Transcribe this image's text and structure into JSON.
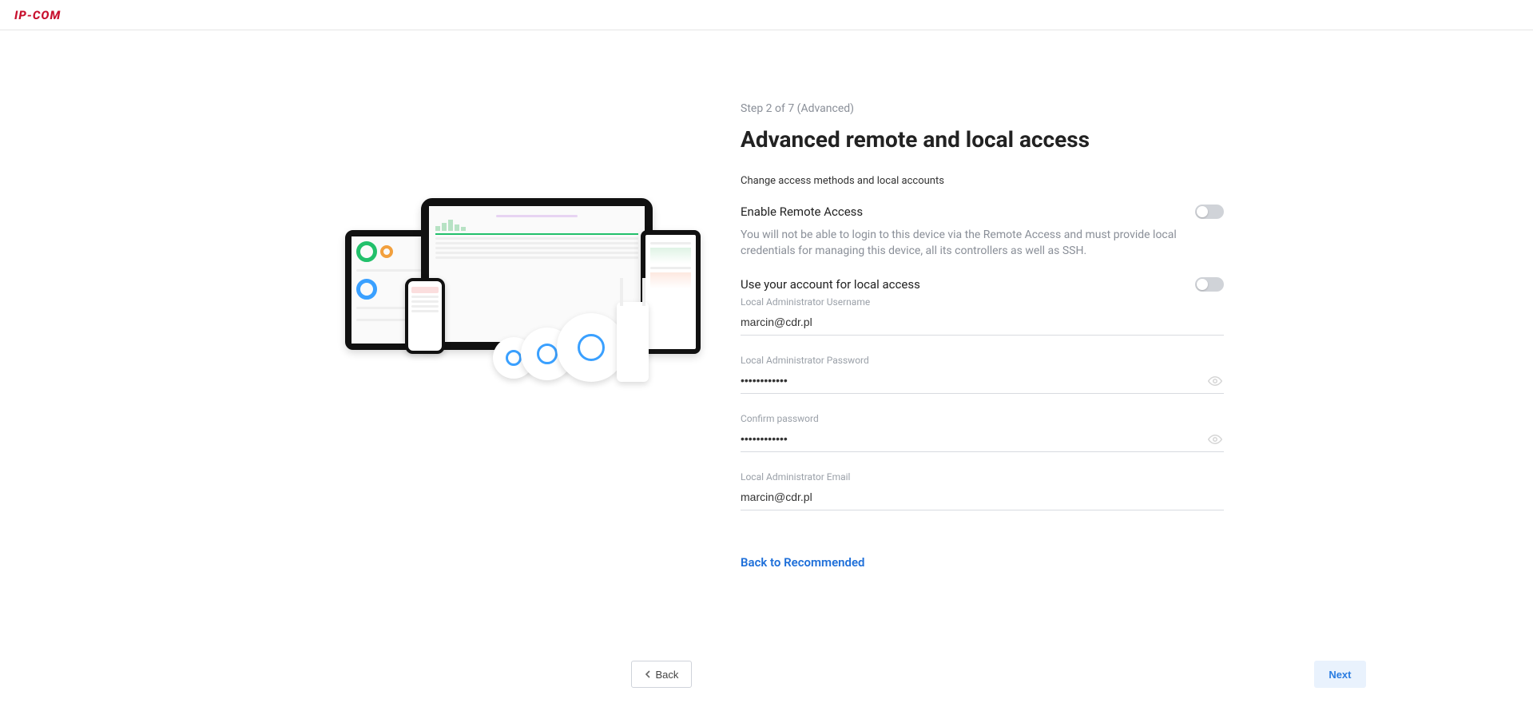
{
  "brand": "IP-COM",
  "step_label": "Step 2 of 7  (Advanced)",
  "title": "Advanced remote and local access",
  "subtitle": "Change access methods and local accounts",
  "remote_access": {
    "label": "Enable Remote Access",
    "help": "You will not be able to login to this device via the Remote Access and must provide local credentials for managing this device, all its controllers as well as SSH.",
    "enabled": false
  },
  "local_account_toggle": {
    "label": "Use your account for local access",
    "enabled": false
  },
  "fields": {
    "username_label": "Local Administrator Username",
    "username_value": "marcin@cdr.pl",
    "password_label": "Local Administrator Password",
    "password_value": "••••••••••••",
    "confirm_label": "Confirm password",
    "confirm_value": "••••••••••••",
    "email_label": "Local Administrator Email",
    "email_value": "marcin@cdr.pl"
  },
  "links": {
    "back_recommended": "Back to Recommended"
  },
  "buttons": {
    "back": "Back",
    "next": "Next"
  }
}
